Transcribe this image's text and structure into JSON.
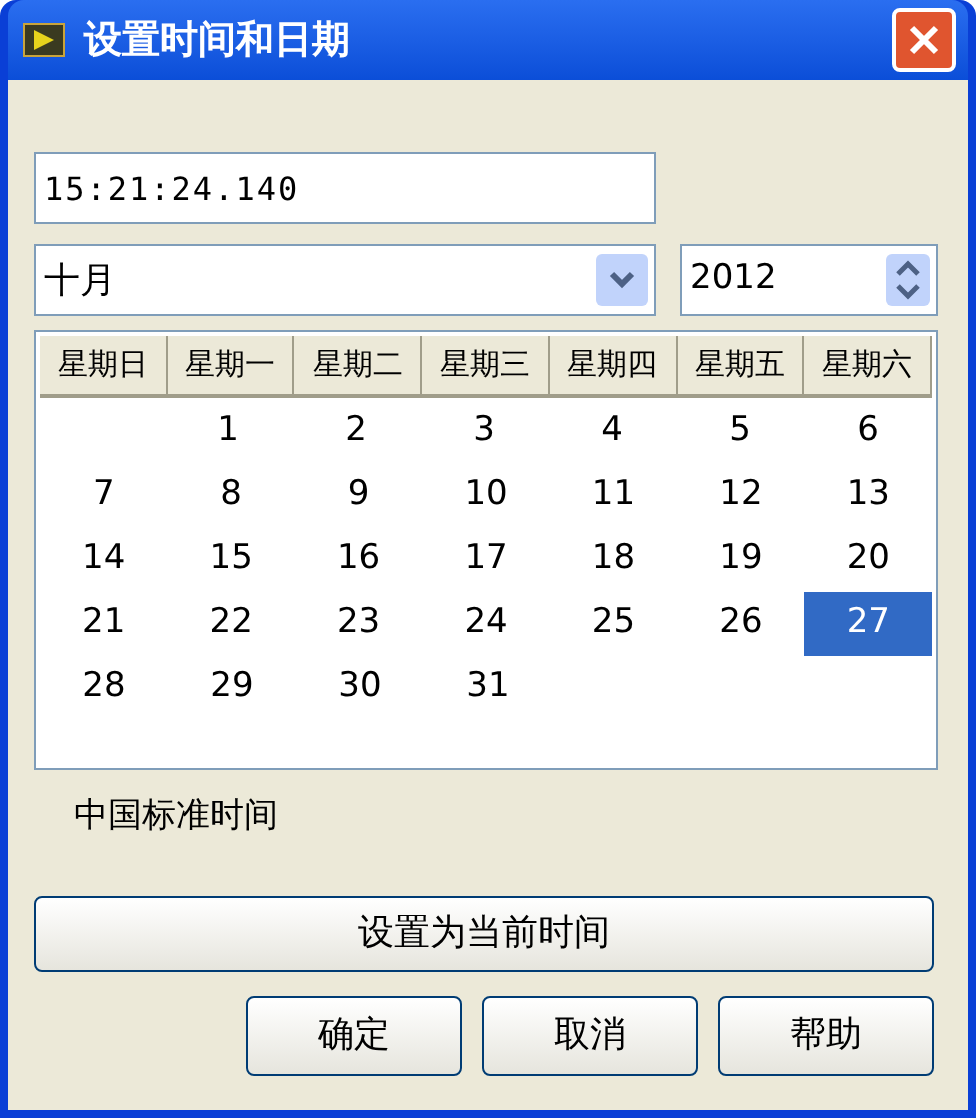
{
  "window": {
    "title": "设置时间和日期"
  },
  "time_field": {
    "value": "15:21:24.140"
  },
  "month_select": {
    "value": "十月"
  },
  "year_spinner": {
    "value": "2012"
  },
  "calendar": {
    "weekdays": [
      "星期日",
      "星期一",
      "星期二",
      "星期三",
      "星期四",
      "星期五",
      "星期六"
    ],
    "weeks": [
      [
        {
          "day": "1",
          "selected": false
        },
        {
          "day": "2",
          "selected": false
        },
        {
          "day": "3",
          "selected": false
        },
        {
          "day": "4",
          "selected": false
        },
        {
          "day": "5",
          "selected": false
        },
        {
          "day": "6",
          "selected": false
        }
      ],
      [
        {
          "day": "7",
          "selected": false
        },
        {
          "day": "8",
          "selected": false
        },
        {
          "day": "9",
          "selected": false
        },
        {
          "day": "10",
          "selected": false
        },
        {
          "day": "11",
          "selected": false
        },
        {
          "day": "12",
          "selected": false
        },
        {
          "day": "13",
          "selected": false
        }
      ],
      [
        {
          "day": "14",
          "selected": false
        },
        {
          "day": "15",
          "selected": false
        },
        {
          "day": "16",
          "selected": false
        },
        {
          "day": "17",
          "selected": false
        },
        {
          "day": "18",
          "selected": false
        },
        {
          "day": "19",
          "selected": false
        },
        {
          "day": "20",
          "selected": false
        }
      ],
      [
        {
          "day": "21",
          "selected": false
        },
        {
          "day": "22",
          "selected": false
        },
        {
          "day": "23",
          "selected": false
        },
        {
          "day": "24",
          "selected": false
        },
        {
          "day": "25",
          "selected": false
        },
        {
          "day": "26",
          "selected": false
        },
        {
          "day": "27",
          "selected": true
        }
      ],
      [
        {
          "day": "28",
          "selected": false
        },
        {
          "day": "29",
          "selected": false
        },
        {
          "day": "30",
          "selected": false
        },
        {
          "day": "31",
          "selected": false
        }
      ]
    ]
  },
  "timezone": "中国标准时间",
  "set_now_button": "设置为当前时间",
  "buttons": [
    "确定",
    "取消",
    "帮助"
  ]
}
